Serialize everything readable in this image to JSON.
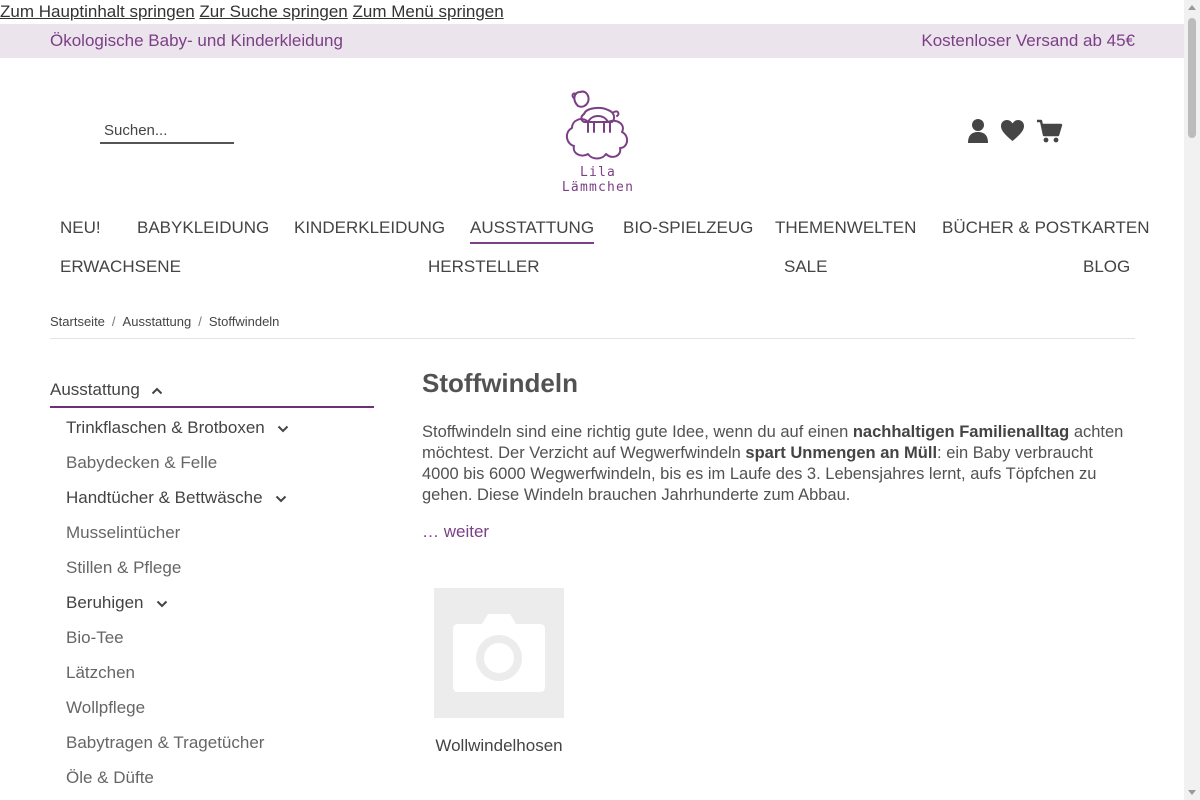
{
  "skip_links": [
    "Zum Hauptinhalt springen",
    "Zur Suche springen",
    "Zum Menü springen"
  ],
  "info_bar": {
    "left": "Ökologische Baby- und Kinderkleidung",
    "right": "Kostenloser Versand ab 45€"
  },
  "search": {
    "placeholder": "Suchen..."
  },
  "logo": {
    "text": "Lila Lämmchen"
  },
  "header_icons": [
    "user-icon",
    "heart-icon",
    "cart-icon"
  ],
  "nav": {
    "row1": [
      "NEU!",
      "BABYKLEIDUNG",
      "KINDERKLEIDUNG",
      "AUSSTATTUNG",
      "BIO-SPIELZEUG",
      "THEMENWELTEN",
      "BÜCHER & POSTKARTEN"
    ],
    "row2": [
      "ERWACHSENE",
      "HERSTELLER",
      "SALE",
      "BLOG"
    ],
    "active": "AUSSTATTUNG"
  },
  "breadcrumb": [
    "Startseite",
    "Ausstattung",
    "Stoffwindeln"
  ],
  "sidebar": {
    "heading": "Ausstattung",
    "items": [
      {
        "label": "Trinkflaschen & Brotboxen",
        "expandable": true
      },
      {
        "label": "Babydecken & Felle",
        "expandable": false
      },
      {
        "label": "Handtücher & Bettwäsche",
        "expandable": true
      },
      {
        "label": "Musselintücher",
        "expandable": false
      },
      {
        "label": "Stillen & Pflege",
        "expandable": false
      },
      {
        "label": "Beruhigen",
        "expandable": true
      },
      {
        "label": "Bio-Tee",
        "expandable": false
      },
      {
        "label": "Lätzchen",
        "expandable": false
      },
      {
        "label": "Wollpflege",
        "expandable": false
      },
      {
        "label": "Babytragen & Tragetücher",
        "expandable": false
      },
      {
        "label": "Öle & Düfte",
        "expandable": false
      }
    ]
  },
  "main": {
    "title": "Stoffwindeln",
    "intro": {
      "p1": "Stoffwindeln sind eine richtig gute Idee, wenn du auf einen ",
      "b1": "nachhaltigen Familienalltag",
      "p2": " achten möchtest. Der Verzicht auf Wegwerfwindeln ",
      "b2": "spart Unmengen an Müll",
      "p3": ": ein Baby verbraucht 4000 bis 6000 Wegwerfwindeln, bis es im Laufe des 3. Lebensjahres lernt, aufs Töpfchen zu gehen. Diese Windeln brauchen Jahrhunderte zum Abbau."
    },
    "more_link": "… weiter",
    "subcategory": {
      "label": "Wollwindelhosen",
      "image_icon": "camera-icon"
    }
  },
  "colors": {
    "accent": "#7b3f86",
    "info_bar_bg": "#ece4ec",
    "text": "#525252"
  }
}
